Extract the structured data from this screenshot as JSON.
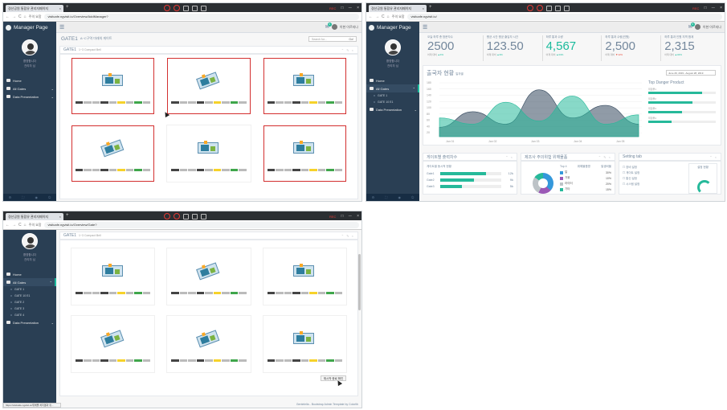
{
  "browser": {
    "tab_title_1": "경산공원 통합유 관리자페이지",
    "tab_title_2": "경산공원 통합유 관리자페이지",
    "tab_title_3": "경산공원 통합유 관리자페이지",
    "tab_close": "×",
    "new_tab": "+",
    "url_1": "visitcafe.ngvisit.io/Overview/AddManager?",
    "url_2": "visitcafe.ngvisit.io/",
    "url_3": "visitcafe.ngvisit.io/Overview/Gate?",
    "secure_label": "주의 요함",
    "record_label": "REC",
    "win_controls": [
      "□",
      "ㅡ",
      "×"
    ],
    "nav_back": "←",
    "nav_fwd": "→",
    "nav_reload": "C",
    "nav_home": "⌂"
  },
  "sidebar": {
    "brand": "Manager Page",
    "user_line1": "환영합니다",
    "user_line2": "관리자 님",
    "menu": [
      {
        "label": "Home",
        "icon": "home-icon"
      },
      {
        "label": "All Gates",
        "icon": "desktop-icon"
      },
      {
        "label": "Data Presentation",
        "icon": "bar-chart-icon"
      }
    ],
    "gates_sub_2": [
      "GATE 1",
      "GATE 10 E1"
    ],
    "gates_sub_3": [
      "GATE 1",
      "GATE 10 E1",
      "GATE 2",
      "GATE 3",
      "GATE 4"
    ],
    "footer_icons": [
      "gear-icon",
      "fullscreen-icon",
      "eye-icon",
      "power-icon"
    ]
  },
  "topnav": {
    "user_name": "이현 이르지나",
    "badge": "6"
  },
  "screen1": {
    "page_title": "GATE1",
    "page_subtitle": "A~C구역 미래의 게이트",
    "search_placeholder": "Search for...",
    "search_go": "Go!",
    "panel_title": "GATE1",
    "panel_subtitle": "1~3 Compact Bell",
    "panel_tools": "⌃ ✎ ×"
  },
  "screen2": {
    "kpis": [
      {
        "label": "오늘 하루 총 방문자수",
        "value": "2500",
        "sub_pre": "어제 대비",
        "sub_val": "4%",
        "trend": "up"
      },
      {
        "label": "평균 시간 평균 출입자 시간",
        "value": "123.50",
        "sub_pre": "어제 대비",
        "sub_val": "3%",
        "trend": "up"
      },
      {
        "label": "하루 통과 수량",
        "value": "4,567",
        "sub_pre": "어제 대비",
        "sub_val": "34%",
        "trend": "up",
        "green": true
      },
      {
        "label": "하루 통과 수량(인원)",
        "value": "2,500",
        "sub_pre": "어제 대비",
        "sub_val": "12%",
        "trend": "down"
      },
      {
        "label": "하루 통과 인원 지역 합계",
        "value": "2,315",
        "sub_pre": "어제 대비",
        "sub_val": "34%",
        "trend": "up"
      }
    ],
    "chart_title": "출국자 현황",
    "chart_subtitle": "일자별",
    "date_range": "June 29, 2019 - August 28, 2019",
    "top_title": "Top Danger Product",
    "top_products": [
      {
        "label": "위험물1",
        "value": 0.8
      },
      {
        "label": "위험물2",
        "value": 0.65
      },
      {
        "label": "위험물3",
        "value": 0.5
      },
      {
        "label": "위험물4",
        "value": 0.35
      }
    ],
    "gate_panel_title": "게이트별 출력차수",
    "gate_panel_sub": "게이트별 동시적 현황",
    "gates": [
      {
        "name": "Gate1",
        "value": "12k",
        "frac": 0.75
      },
      {
        "name": "Gate2",
        "value": "9k",
        "frac": 0.55
      },
      {
        "name": "Gate3",
        "value": "5k",
        "frac": 0.35
      }
    ],
    "danger_panel_title": "제조사 주의위험 위해물품",
    "danger_head": [
      "Top 4",
      "위해물품명",
      "발생비율"
    ],
    "danger_items": [
      {
        "label": "칼",
        "pct": "30%",
        "color": "#3498db"
      },
      {
        "label": "가위",
        "pct": "10%",
        "color": "#9b59b6"
      },
      {
        "label": "라이터",
        "pct": "20%",
        "color": "#bdc3c7"
      },
      {
        "label": "기타",
        "pct": "15%",
        "color": "#26b99a"
      }
    ],
    "setting_title": "Setting tab",
    "settings": [
      "☐ 장비 설정",
      "☐ 게이트 설정",
      "☐ 통신 설정",
      "☐ 시스템 설정"
    ],
    "gauge_label": "설정 현황"
  },
  "chart_data": {
    "type": "area",
    "title": "출국자 현황",
    "x": [
      "Jan 01",
      "Jan 02",
      "Jan 03",
      "Jan 04",
      "Jan 05"
    ],
    "ylim": [
      0,
      180
    ],
    "yticks": [
      "180",
      "160",
      "140",
      "120",
      "100",
      "80",
      "60",
      "40",
      "20"
    ],
    "series": [
      {
        "values": [
          30,
          80,
          40,
          150,
          60,
          100,
          40
        ]
      },
      {
        "values": [
          60,
          40,
          110,
          50,
          130,
          40,
          70
        ]
      }
    ]
  },
  "screen3": {
    "panel_title": "GATE1",
    "panel_subtitle": "1~3 Compact Bell",
    "exit_button": "재시작 종료 확인",
    "footer": "Gentelella - Bootstrap Admin Template by Colorlib",
    "status": "https://visitcafe.ngvisit.io/위해물 처리결과 취..."
  }
}
